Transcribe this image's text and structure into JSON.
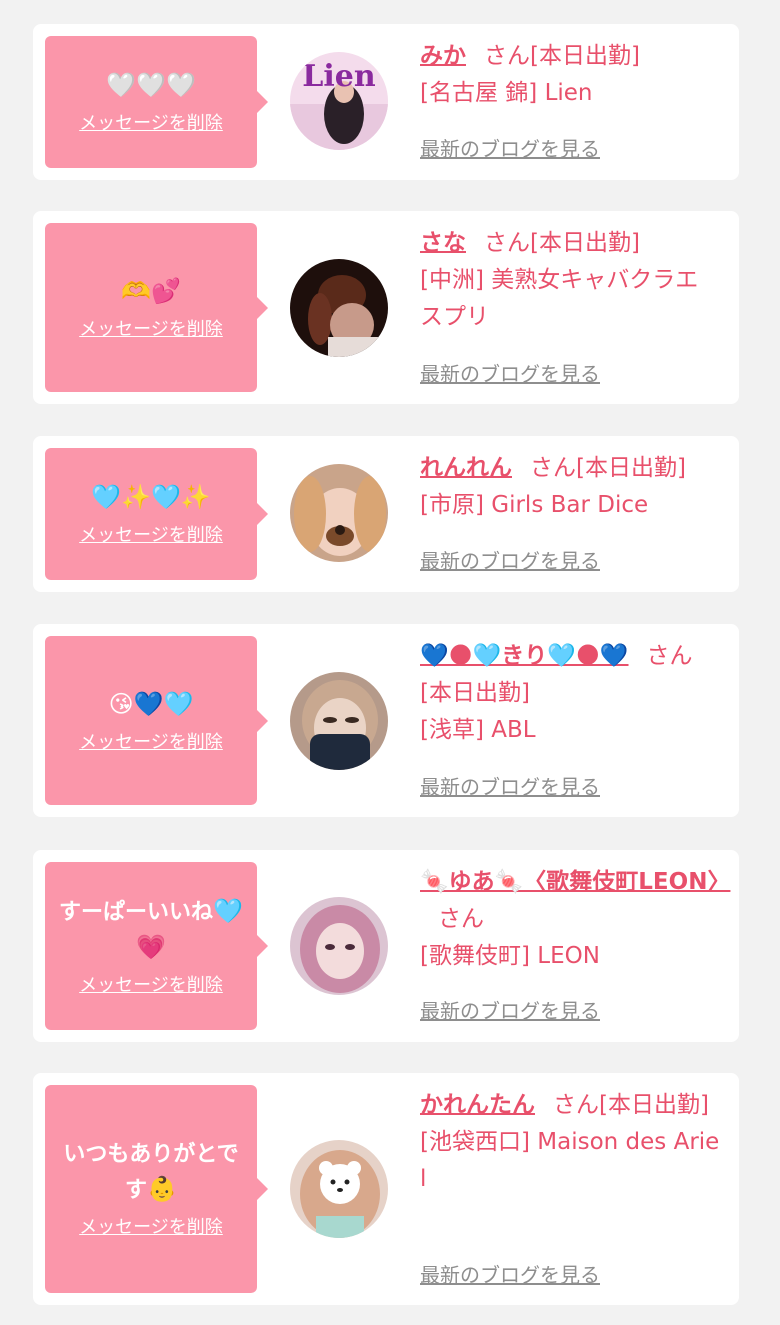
{
  "messages": [
    {
      "message": "",
      "message_emoji": "🤍🤍🤍",
      "delete_label": "メッセージを削除",
      "name": "みか",
      "honorific": "さん",
      "status": "[本日出勤]",
      "area": "[名古屋 錦]",
      "shop": "Lien",
      "blog_link": "最新のブログを見る",
      "avatar_logo_text": "Lien"
    },
    {
      "message": "",
      "message_emoji": "🫶💕",
      "delete_label": "メッセージを削除",
      "name": "さな",
      "honorific": "さん",
      "status": "[本日出勤]",
      "area": "[中洲]",
      "shop": "美熟女キャバクラエスプリ",
      "blog_link": "最新のブログを見る"
    },
    {
      "message": "",
      "message_emoji": "🩵✨🩵✨",
      "delete_label": "メッセージを削除",
      "name": "れんれん",
      "honorific": "さん",
      "status": "[本日出勤]",
      "area": "[市原]",
      "shop": "Girls Bar Dice",
      "blog_link": "最新のブログを見る"
    },
    {
      "message": "",
      "message_emoji": "😘💙🩵",
      "delete_label": "メッセージを削除",
      "name": "💙🌑🩵きり🩵🌑💙",
      "honorific": "さん",
      "status": "[本日出勤]",
      "area": "[浅草]",
      "shop": "ABL",
      "blog_link": "最新のブログを見る"
    },
    {
      "message": "すーぱーいいね",
      "message_emoji": "🩵💗",
      "delete_label": "メッセージを削除",
      "name": "🍬ゆあ🍬〈歌舞伎町LEON〉",
      "honorific": "さん",
      "status": "",
      "area": "[歌舞伎町]",
      "shop": "LEON",
      "blog_link": "最新のブログを見る"
    },
    {
      "message": "いつもありがとです",
      "message_emoji": "👶",
      "delete_label": "メッセージを削除",
      "name": "かれんたん",
      "honorific": "さん",
      "status": "[本日出勤]",
      "area": "[池袋西口]",
      "shop": "Maison des Ariel",
      "blog_link": "最新のブログを見る"
    }
  ],
  "colors": {
    "background": "#f2f2f2",
    "bubble": "#fb96aa",
    "accent_pink": "#e8506b",
    "blog_link_gray": "#8e8e8e"
  }
}
